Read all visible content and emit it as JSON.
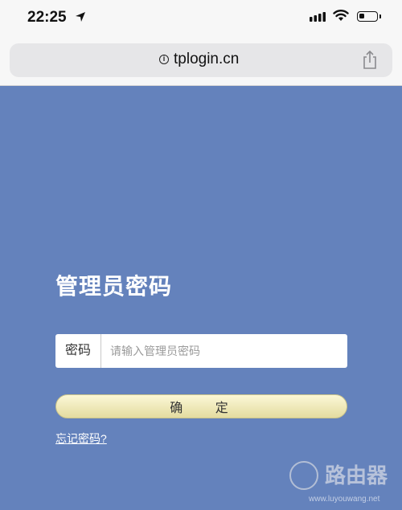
{
  "status_bar": {
    "time": "22:25",
    "battery_level": 0.3
  },
  "browser": {
    "url": "tplogin.cn"
  },
  "login": {
    "title": "管理员密码",
    "password_label": "密码",
    "password_placeholder": "请输入管理员密码",
    "confirm_label": "确 定",
    "forgot_label": "忘记密码?"
  },
  "watermark": {
    "name": "路由器",
    "url": "www.luyouwang.net"
  },
  "colors": {
    "page_background": "#6482bc",
    "button": "#efe7b3",
    "browser_bar": "#e6e6e8"
  }
}
